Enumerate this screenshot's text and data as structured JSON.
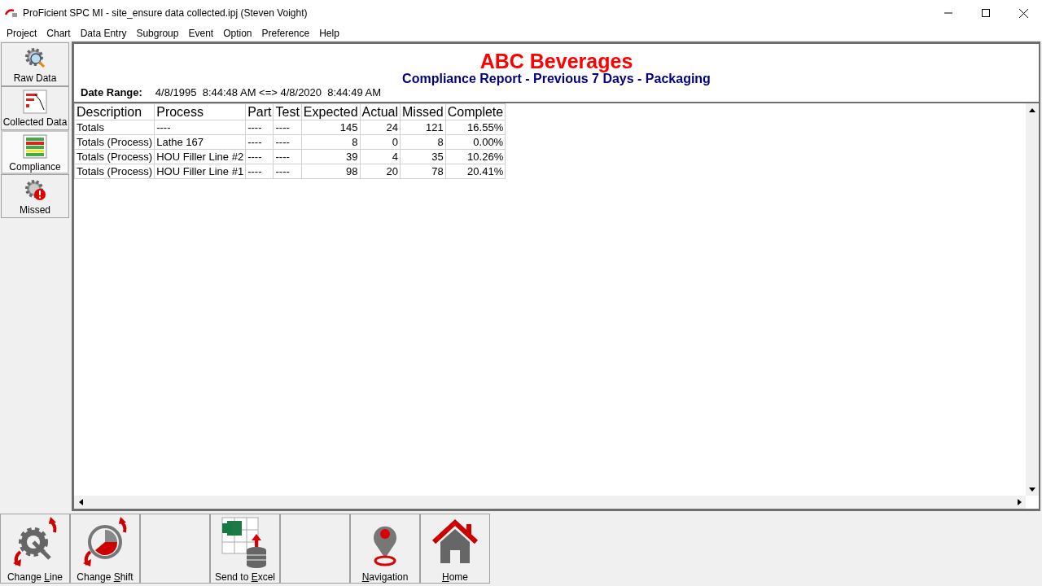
{
  "window": {
    "title": "ProFicient SPC MI - site_ensure data collected.ipj (Steven Voight)"
  },
  "menu": [
    "Project",
    "Chart",
    "Data Entry",
    "Subgroup",
    "Event",
    "Option",
    "Preference",
    "Help"
  ],
  "sidebar": {
    "items": [
      {
        "label": "Raw Data",
        "kind": "raw",
        "selected": false
      },
      {
        "label": "Collected Data",
        "kind": "collected",
        "selected": false
      },
      {
        "label": "Compliance",
        "kind": "compliance",
        "selected": true
      },
      {
        "label": "Missed",
        "kind": "missed",
        "selected": false
      }
    ]
  },
  "report": {
    "company": "ABC Beverages",
    "subtitle": "Compliance Report - Previous 7 Days - Packaging",
    "date_range_label": "Date Range:",
    "date_range": "4/8/1995  8:44:48 AM <=> 4/8/2020  8:44:49 AM"
  },
  "table": {
    "columns": [
      "Description",
      "Process",
      "Part",
      "Test",
      "Expected",
      "Actual",
      "Missed",
      "Complete"
    ],
    "rows": [
      [
        "Totals",
        "----",
        "----",
        "----",
        "145",
        "24",
        "121",
        "16.55%"
      ],
      [
        "Totals (Process)",
        "Lathe 167",
        "----",
        "----",
        "8",
        "0",
        "8",
        "0.00%"
      ],
      [
        "Totals (Process)",
        "HOU Filler Line #2",
        "----",
        "----",
        "39",
        "4",
        "35",
        "10.26%"
      ],
      [
        "Totals (Process)",
        "HOU Filler Line #1",
        "----",
        "----",
        "98",
        "20",
        "78",
        "20.41%"
      ]
    ]
  },
  "toolbar": [
    {
      "kind": "change_line",
      "prefix": "Change ",
      "access_key": "L",
      "rest": "ine"
    },
    {
      "kind": "change_shift",
      "prefix": "Change ",
      "access_key": "S",
      "rest": "hift"
    },
    {
      "kind": "empty"
    },
    {
      "kind": "excel",
      "prefix": "Send to ",
      "access_key": "E",
      "rest": "xcel"
    },
    {
      "kind": "empty"
    },
    {
      "kind": "navigation",
      "access_key": "N",
      "rest": "avigation"
    },
    {
      "kind": "home",
      "access_key": "H",
      "rest": "ome"
    }
  ]
}
